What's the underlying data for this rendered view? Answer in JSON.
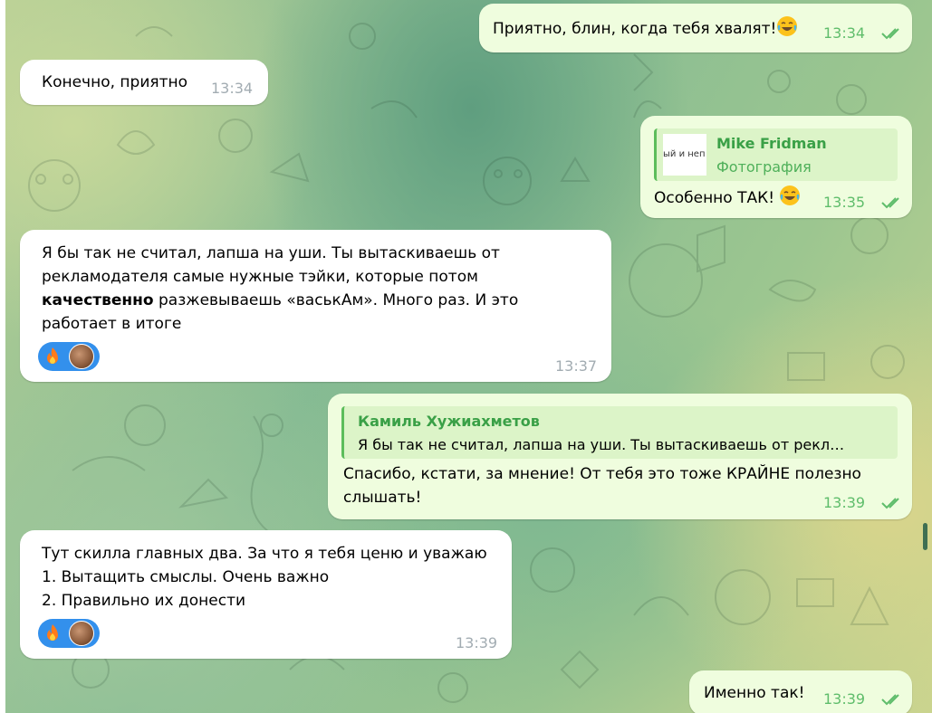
{
  "chat": {
    "messages": [
      {
        "id": "m1",
        "direction": "outgoing",
        "text": "Приятно, блин, когда тебя хвалят!",
        "emoji": "tears-of-joy-emoji",
        "time": "13:34",
        "status": "read"
      },
      {
        "id": "m2",
        "direction": "incoming",
        "text": "Конечно, приятно",
        "time": "13:34"
      },
      {
        "id": "m3",
        "direction": "outgoing",
        "reply": {
          "author": "Mike Fridman",
          "subtitle": "Фотография",
          "thumbnail_text": "ый и неп"
        },
        "text": "Особенно ТАК!",
        "emoji": "tears-of-joy-emoji",
        "time": "13:35",
        "status": "read"
      },
      {
        "id": "m4",
        "direction": "incoming",
        "lines": [
          "Я бы так не считал, лапша на уши. Ты вытаскиваешь от",
          "рекламодателя самые нужные тэйки, которые потом",
          "разжевываешь «васькАм». Много раз. И это",
          "работает в итоге"
        ],
        "bold_word": "качественно",
        "reactions": [
          "fire-emoji",
          "reactor-avatar"
        ],
        "time": "13:37"
      },
      {
        "id": "m5",
        "direction": "outgoing",
        "reply": {
          "author": "Камиль Хужиахметов",
          "quote": "Я бы так не считал, лапша на уши. Ты вытаскиваешь от рекл…"
        },
        "lines": [
          "Спасибо, кстати, за мнение! От тебя это тоже КРАЙНЕ полезно",
          "слышать!"
        ],
        "time": "13:39",
        "status": "read"
      },
      {
        "id": "m6",
        "direction": "incoming",
        "lines": [
          "Тут скилла главных два. За что я тебя ценю и уважаю",
          "1. Вытащить смыслы. Очень важно",
          "2. Правильно их донести"
        ],
        "reactions": [
          "fire-emoji",
          "reactor-avatar"
        ],
        "time": "13:39"
      },
      {
        "id": "m7",
        "direction": "outgoing",
        "text": "Именно так!",
        "time": "13:39",
        "status": "read"
      }
    ]
  },
  "colors": {
    "incoming_bubble": "#ffffff",
    "outgoing_bubble": "#effdde",
    "outgoing_time": "#5fbd6b",
    "incoming_time": "#a2acb2",
    "reply_accent": "#5cbd5b",
    "reaction_bg": "#3390ec"
  }
}
